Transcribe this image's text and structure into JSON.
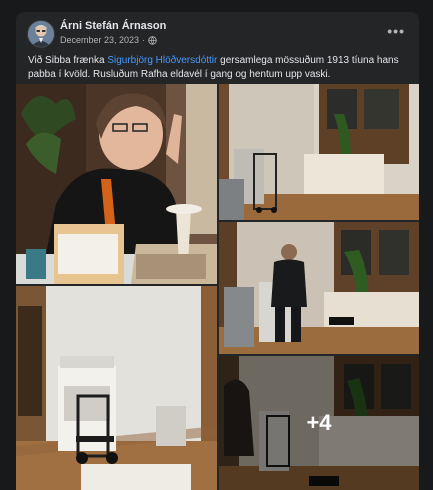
{
  "post": {
    "author": "Árni Stefán Árnason",
    "date": "December 23, 2023",
    "separator": "·",
    "more_label": "•••",
    "text_before": "Við Sibba frænka ",
    "mention": "Sigurbjörg Hlöðversdóttir",
    "text_after": " gersamlega mössuðum 1913 tíuna hans pabba í kvöld. Rusluðum Rafha eldavél í gang og hentum upp vaski."
  },
  "gallery": {
    "more_count": "+4"
  },
  "icons": {
    "privacy": "globe-icon",
    "more": "more-options-icon"
  },
  "colors": {
    "card_bg": "#242526",
    "link": "#4599ff",
    "text": "#e4e6eb",
    "muted": "#b0b3b8"
  }
}
